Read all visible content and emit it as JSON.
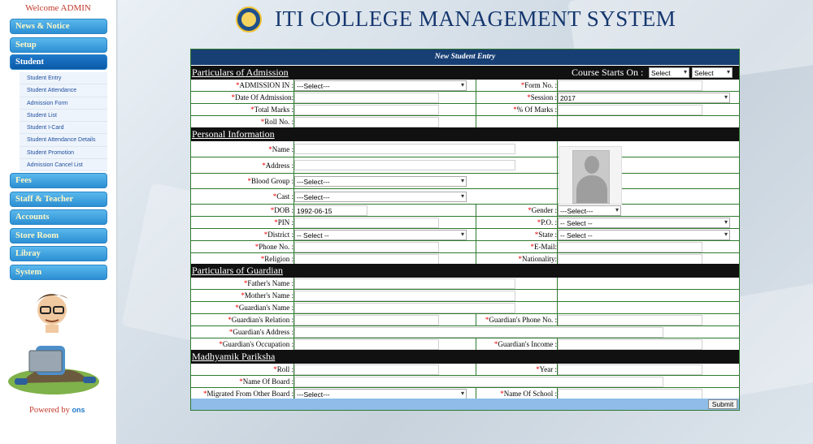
{
  "sidebar": {
    "welcome": "Welcome ADMIN",
    "menu": [
      {
        "label": "News & Notice"
      },
      {
        "label": "Setup"
      },
      {
        "label": "Student"
      },
      {
        "label": "Fees"
      },
      {
        "label": "Staff & Teacher"
      },
      {
        "label": "Accounts"
      },
      {
        "label": "Store Room"
      },
      {
        "label": "Libray"
      },
      {
        "label": "System"
      }
    ],
    "student_submenu": [
      "Student Entry",
      "Student Attendance",
      "Admission Form",
      "Student List",
      "Student I-Card",
      "Student Attendance Details",
      "Student Promotion",
      "Admission Cancel List"
    ],
    "powered_by": "Powered by",
    "powered_logo": "ons"
  },
  "header": {
    "title": "ITI COLLEGE MANAGEMENT SYSTEM"
  },
  "form": {
    "title": "New Student Entry",
    "sections": {
      "admission": "Particulars of Admission",
      "personal": "Personal Information",
      "guardian": "Particulars of Guardian",
      "madhyamik": "Madhyamik Pariksha"
    },
    "course_starts_label": "Course Starts On :",
    "course_starts_selects": [
      "Select",
      "Select"
    ],
    "fields": {
      "admission_in": {
        "label": "ADMISSION IN :",
        "value": "---Select---"
      },
      "form_no": {
        "label": "Form No. :",
        "value": ""
      },
      "date_of_admission": {
        "label": "Date Of Admission:",
        "value": ""
      },
      "session": {
        "label": "Session :",
        "value": "2017"
      },
      "total_marks": {
        "label": "Total Marks :",
        "value": ""
      },
      "pct_marks": {
        "label": "% Of Marks :",
        "value": ""
      },
      "roll_no": {
        "label": "Roll No. :",
        "value": ""
      },
      "name": {
        "label": "Name :",
        "value": ""
      },
      "address": {
        "label": "Address :",
        "value": ""
      },
      "blood_group": {
        "label": "Blood Group :",
        "value": "---Select---"
      },
      "cast": {
        "label": "Cast :",
        "value": "---Select---"
      },
      "dob": {
        "label": "DOB :",
        "value": "1992-06-15"
      },
      "gender": {
        "label": "Gender :",
        "value": "---Select---"
      },
      "pin": {
        "label": "PIN :",
        "value": ""
      },
      "po": {
        "label": "P.O. :",
        "value": "-- Select --"
      },
      "district": {
        "label": "District :",
        "value": "-- Select --"
      },
      "state": {
        "label": "State :",
        "value": "-- Select --"
      },
      "phone": {
        "label": "Phone No. :",
        "value": ""
      },
      "email": {
        "label": "E-Mail:",
        "value": ""
      },
      "religion": {
        "label": "Religion :",
        "value": ""
      },
      "nationality": {
        "label": "Nationality:",
        "value": ""
      },
      "father_name": {
        "label": "Father's Name :",
        "value": ""
      },
      "mother_name": {
        "label": "Mother's Name :",
        "value": ""
      },
      "guardian_name": {
        "label": "Guardian's Name :",
        "value": ""
      },
      "guardian_relation": {
        "label": "Guardian's Relation :",
        "value": ""
      },
      "guardian_phone": {
        "label": "Guardian's Phone No. :",
        "value": ""
      },
      "guardian_address": {
        "label": "Guardian's Address :",
        "value": ""
      },
      "guardian_occupation": {
        "label": "Guardian's Occupation :",
        "value": ""
      },
      "guardian_income": {
        "label": "Guardian's Income :",
        "value": ""
      },
      "mp_roll": {
        "label": "Roll :",
        "value": ""
      },
      "mp_year": {
        "label": "Year :",
        "value": ""
      },
      "board_name": {
        "label": "Name Of Board :",
        "value": ""
      },
      "migrated": {
        "label": "Migrated From Other Board :",
        "value": "---Select---"
      },
      "school_name": {
        "label": "Name Of School :",
        "value": ""
      }
    },
    "submit_label": "Submit"
  },
  "colors": {
    "form_header": "#173f74",
    "section_bar": "#111111",
    "menu_button": "#2c8fd3",
    "menu_active": "#0b5aa8",
    "required_star": "#ee0000",
    "grid_line": "#2f7a2f",
    "submit_bar": "#8fbce8"
  }
}
